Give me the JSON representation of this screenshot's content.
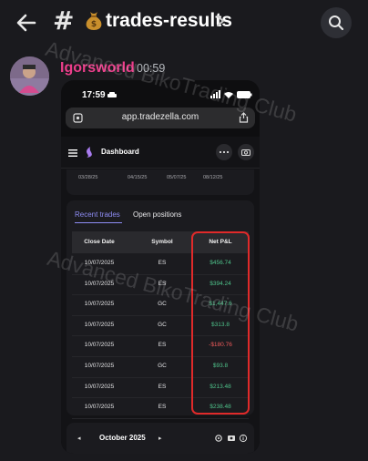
{
  "header": {
    "channel_name": "trades-results",
    "back_icon": "back-arrow-icon",
    "hash_icon": "#",
    "emoji_icon": "money-bag-icon",
    "search_icon": "search-icon"
  },
  "message": {
    "username": "Igorsworld",
    "time": "00:59",
    "username_color": "#ec3e8b"
  },
  "phone": {
    "status_time": "17:59",
    "url": "app.tradezella.com",
    "app_title": "Dashboard",
    "chart_dates": [
      "03/28/25",
      "04/15/25",
      "05/07/25",
      "08/12/25"
    ],
    "tabs": [
      "Recent trades",
      "Open positions"
    ],
    "columns": [
      "Close Date",
      "Symbol",
      "Net P&L"
    ],
    "rows": [
      {
        "date": "10/07/2025",
        "symbol": "ES",
        "pnl": "$456.74",
        "positive": true
      },
      {
        "date": "10/07/2025",
        "symbol": "ES",
        "pnl": "$394.24",
        "positive": true
      },
      {
        "date": "10/07/2025",
        "symbol": "GC",
        "pnl": "$1,447.6",
        "positive": true
      },
      {
        "date": "10/07/2025",
        "symbol": "GC",
        "pnl": "$313.8",
        "positive": true
      },
      {
        "date": "10/07/2025",
        "symbol": "ES",
        "pnl": "-$180.76",
        "positive": false
      },
      {
        "date": "10/07/2025",
        "symbol": "GC",
        "pnl": "$93.8",
        "positive": true
      },
      {
        "date": "10/07/2025",
        "symbol": "ES",
        "pnl": "$213.48",
        "positive": true
      },
      {
        "date": "10/07/2025",
        "symbol": "ES",
        "pnl": "$238.48",
        "positive": true
      }
    ],
    "month": "October 2025",
    "prev_symbol": "◂",
    "next_symbol": "▸",
    "positive_color": "#4fc38b",
    "negative_color": "#ee5a5a"
  },
  "watermark": "Advanced BikoTrading Club"
}
